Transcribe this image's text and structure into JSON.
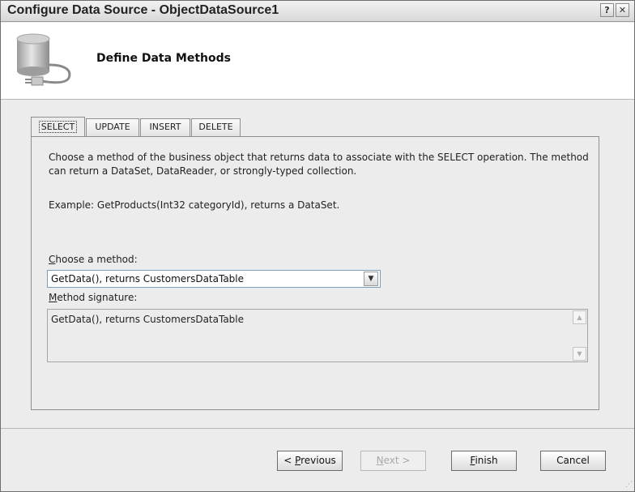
{
  "window": {
    "title": "Configure Data Source - ObjectDataSource1",
    "help_label": "?",
    "close_label": "✕"
  },
  "header": {
    "heading": "Define Data Methods",
    "icon": "database-plug-icon"
  },
  "tabs": [
    {
      "label": "SELECT",
      "active": true
    },
    {
      "label": "UPDATE",
      "active": false
    },
    {
      "label": "INSERT",
      "active": false
    },
    {
      "label": "DELETE",
      "active": false
    }
  ],
  "panel": {
    "description": "Choose a method of the business object that returns data to associate with the SELECT operation. The method can return a DataSet, DataReader, or strongly-typed collection.",
    "example": "Example: GetProducts(Int32 categoryId), returns a DataSet.",
    "choose_label": {
      "mnemonic": "C",
      "rest": "hoose a method:"
    },
    "method_value": "GetData(), returns CustomersDataTable",
    "signature_label": {
      "mnemonic": "M",
      "rest": "ethod signature:"
    },
    "signature_value": "GetData(), returns CustomersDataTable"
  },
  "buttons": {
    "previous": {
      "prefix": "< ",
      "mnemonic": "P",
      "rest": "revious",
      "enabled": true
    },
    "next": {
      "mnemonic": "N",
      "rest": "ext >",
      "enabled": false
    },
    "finish": {
      "mnemonic": "F",
      "rest": "inish",
      "enabled": true
    },
    "cancel": {
      "label": "Cancel",
      "enabled": true
    }
  }
}
